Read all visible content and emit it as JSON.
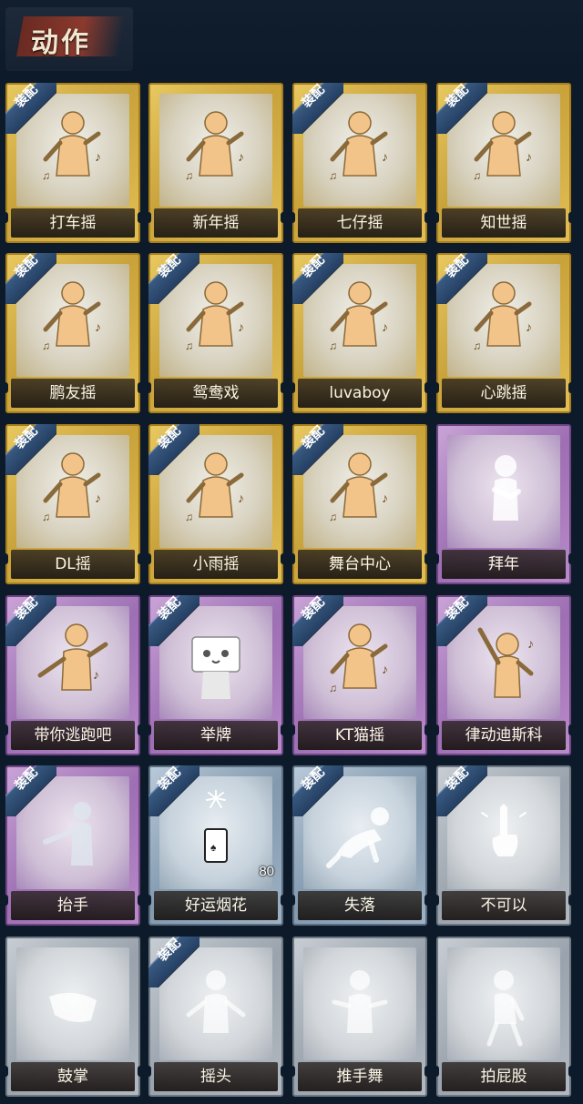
{
  "header": {
    "title": "动作"
  },
  "badge_label": "装配",
  "cards": [
    {
      "label": "打车摇",
      "tier": "gold",
      "equipped": true,
      "figure": "dancer-icon"
    },
    {
      "label": "新年摇",
      "tier": "gold",
      "equipped": false,
      "figure": "dancer-icon"
    },
    {
      "label": "七仔摇",
      "tier": "gold",
      "equipped": true,
      "figure": "dancer-icon"
    },
    {
      "label": "知世摇",
      "tier": "gold",
      "equipped": true,
      "figure": "dancer-icon"
    },
    {
      "label": "鹏友摇",
      "tier": "gold",
      "equipped": true,
      "figure": "dancer-icon"
    },
    {
      "label": "鸳鸯戏",
      "tier": "gold",
      "equipped": true,
      "figure": "dancer-icon"
    },
    {
      "label": "luvaboy",
      "tier": "gold",
      "equipped": true,
      "figure": "dancer-icon"
    },
    {
      "label": "心跳摇",
      "tier": "gold",
      "equipped": true,
      "figure": "dancer-icon"
    },
    {
      "label": "DL摇",
      "tier": "gold",
      "equipped": true,
      "figure": "dancer-icon"
    },
    {
      "label": "小雨摇",
      "tier": "gold",
      "equipped": true,
      "figure": "dancer-icon"
    },
    {
      "label": "舞台中心",
      "tier": "gold",
      "equipped": true,
      "figure": "dancer-icon"
    },
    {
      "label": "拜年",
      "tier": "purple",
      "equipped": false,
      "figure": "bow-icon"
    },
    {
      "label": "带你逃跑吧",
      "tier": "purple",
      "equipped": true,
      "figure": "pointing-dancer-icon"
    },
    {
      "label": "举牌",
      "tier": "purple",
      "equipped": true,
      "figure": "sign-holder-icon"
    },
    {
      "label": "KT猫摇",
      "tier": "purple",
      "equipped": true,
      "figure": "dancer-icon"
    },
    {
      "label": "律动迪斯科",
      "tier": "purple",
      "equipped": true,
      "figure": "disco-icon"
    },
    {
      "label": "抬手",
      "tier": "purple",
      "equipped": true,
      "figure": "raise-hand-icon"
    },
    {
      "label": "好运烟花",
      "tier": "blue",
      "equipped": true,
      "figure": "firework-icon",
      "count": "80"
    },
    {
      "label": "失落",
      "tier": "blue",
      "equipped": true,
      "figure": "kneel-icon"
    },
    {
      "label": "不可以",
      "tier": "grey",
      "equipped": true,
      "figure": "finger-wag-icon"
    },
    {
      "label": "鼓掌",
      "tier": "grey",
      "equipped": false,
      "figure": "clap-icon"
    },
    {
      "label": "摇头",
      "tier": "grey",
      "equipped": true,
      "figure": "shake-head-icon"
    },
    {
      "label": "推手舞",
      "tier": "grey",
      "equipped": false,
      "figure": "push-hands-icon"
    },
    {
      "label": "拍屁股",
      "tier": "grey",
      "equipped": false,
      "figure": "pat-icon"
    }
  ]
}
